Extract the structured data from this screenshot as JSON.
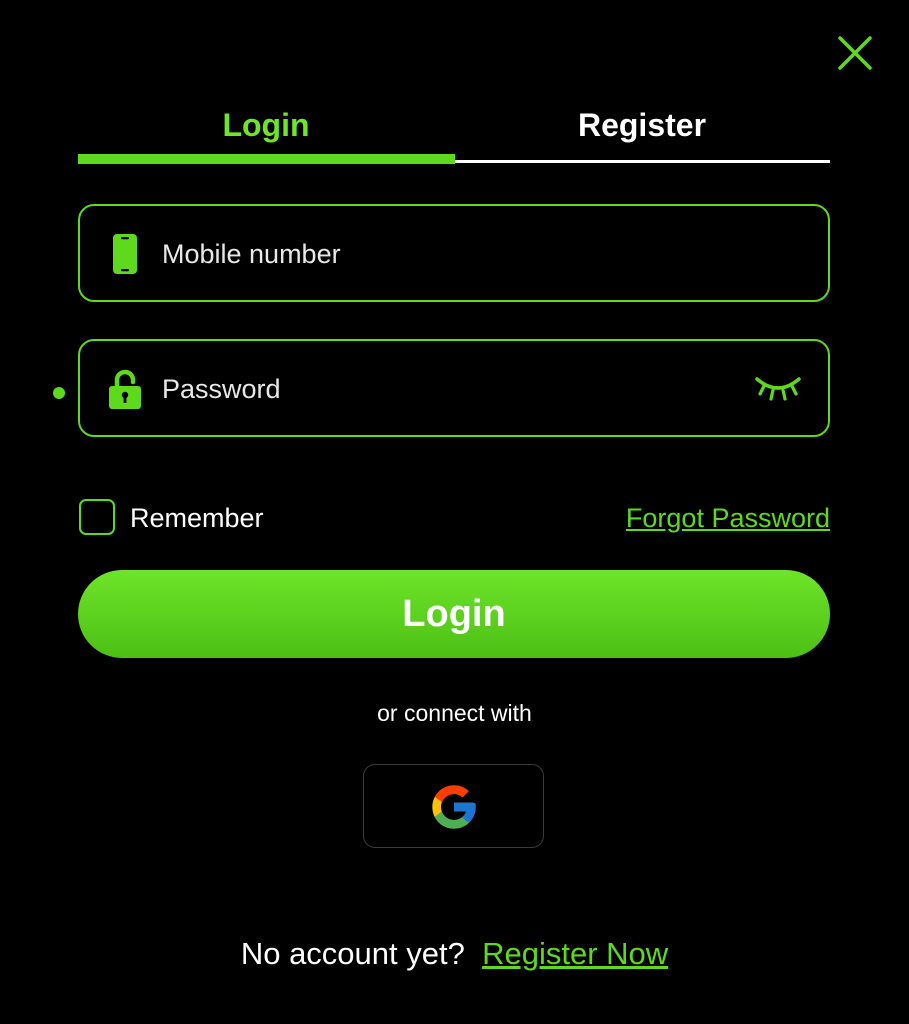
{
  "close": {
    "icon": "close-icon"
  },
  "tabs": [
    {
      "label": "Login",
      "active": true
    },
    {
      "label": "Register",
      "active": false
    }
  ],
  "mobile": {
    "icon": "phone-icon",
    "placeholder": "Mobile number",
    "value": ""
  },
  "password": {
    "icon": "lock-icon",
    "placeholder": "Password",
    "value": "",
    "toggle_icon": "eye-closed-icon"
  },
  "remember": {
    "label": "Remember",
    "checked": false
  },
  "forgot": {
    "label": "Forgot Password"
  },
  "login_button": {
    "label": "Login"
  },
  "connect": {
    "label": "or connect with"
  },
  "social": [
    {
      "name": "Google",
      "icon": "google-icon"
    }
  ],
  "footer": {
    "text": "No account yet?",
    "link": "Register Now"
  },
  "colors": {
    "accent": "#5ed91c",
    "background": "#000000",
    "text": "#ffffff"
  }
}
